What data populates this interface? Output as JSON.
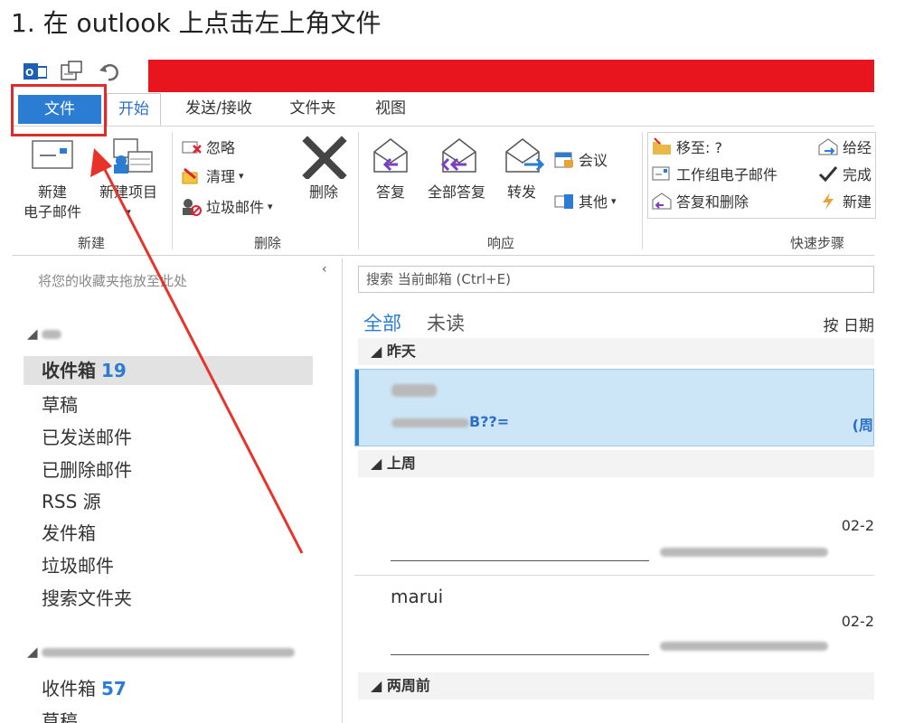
{
  "caption": "1. 在 outlook 上点击左上角文件",
  "tabs": [
    {
      "label": "文件"
    },
    {
      "label": "开始"
    },
    {
      "label": "发送/接收"
    },
    {
      "label": "文件夹"
    },
    {
      "label": "视图"
    }
  ],
  "ribbon": {
    "new_email": "新建",
    "new_email_2": "电子邮件",
    "new_items": "新建项目",
    "group_new": "新建",
    "ignore": "忽略",
    "clean": "清理",
    "junk": "垃圾邮件",
    "delete": "删除",
    "group_delete": "删除",
    "reply": "答复",
    "reply_all": "全部答复",
    "forward": "转发",
    "meeting": "会议",
    "more": "其他",
    "group_respond": "响应",
    "move_to": "移至: ?",
    "team_email": "工作组电子邮件",
    "reply_delete": "答复和删除",
    "to_manager": "给经",
    "done": "完成",
    "create_new": "新建",
    "group_quick": "快速步骤"
  },
  "nav": {
    "favorites_hint": "将您的收藏夹拖放至此处",
    "collapse": "‹",
    "folders1": [
      {
        "label": "收件箱",
        "count": "19"
      },
      {
        "label": "草稿"
      },
      {
        "label": "已发送邮件"
      },
      {
        "label": "已删除邮件"
      },
      {
        "label": "RSS 源"
      },
      {
        "label": "发件箱"
      },
      {
        "label": "垃圾邮件"
      },
      {
        "label": "搜索文件夹"
      }
    ],
    "folders2": [
      {
        "label": "收件箱",
        "count": "57"
      },
      {
        "label": "草稿"
      }
    ]
  },
  "list": {
    "search_placeholder": "搜索 当前邮箱 (Ctrl+E)",
    "filter_all": "全部",
    "filter_unread": "未读",
    "sort": "按 日期",
    "group_yesterday": "◢ 昨天",
    "group_lastweek": "◢ 上周",
    "group_twoweeks": "◢ 两周前",
    "mail1": {
      "subject_suffix": "B??=",
      "date": "(周"
    },
    "mail2": {
      "date": "02-2"
    },
    "mail3": {
      "sender": "marui",
      "date": "02-2"
    }
  },
  "colors": {
    "accent": "#2b7cd3",
    "red_bar": "#e8141e",
    "arrow": "#e8332a"
  }
}
